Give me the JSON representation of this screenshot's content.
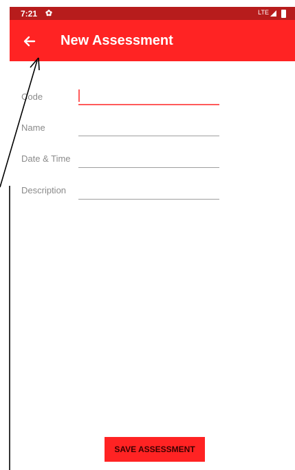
{
  "status_bar": {
    "time": "7:21",
    "settings_icon": "gear-icon",
    "network": "LTE",
    "signal_icon": "signal-icon",
    "battery_icon": "battery-icon"
  },
  "app_bar": {
    "back_icon": "arrow-left-icon",
    "title": "New Assessment",
    "color": "#ff2323"
  },
  "form": {
    "code_label": "Code",
    "code_value": "",
    "name_label": "Name",
    "name_value": "",
    "datetime_label": "Date & Time",
    "datetime_value": "",
    "description_label": "Description",
    "description_value": ""
  },
  "actions": {
    "save_label": "SAVE ASSESSMENT"
  },
  "colors": {
    "status_bar": "#b71c1c",
    "accent": "#ff2323",
    "focused_underline": "#ff5a5a"
  }
}
